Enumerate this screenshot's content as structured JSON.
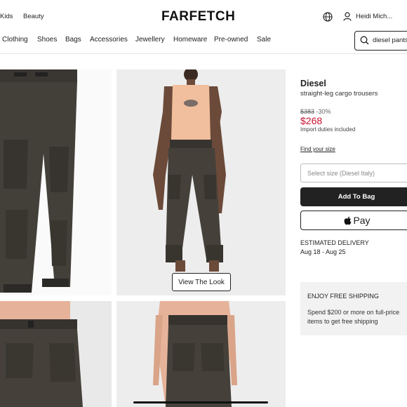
{
  "top_nav": {
    "kids": "Kids",
    "beauty": "Beauty",
    "logo": "FARFETCH",
    "user": "Heidi Mich..."
  },
  "categories": [
    "Clothing",
    "Shoes",
    "Bags",
    "Accessories",
    "Jewellery",
    "Homeware",
    "Pre-owned",
    "Sale"
  ],
  "search": {
    "value": "diesel pants"
  },
  "product": {
    "brand": "Diesel",
    "name": "straight-leg cargo trousers",
    "original_price": "$383",
    "discount": "-30%",
    "price": "$268",
    "duties": "Import duties included",
    "find_size": "Find your size",
    "size_placeholder": "Select size (Diesel Italy)",
    "add_to_bag": "Add To Bag",
    "apple_pay": "Pay"
  },
  "gallery": {
    "view_look": "View The Look"
  },
  "delivery": {
    "heading": "ESTIMATED DELIVERY",
    "dates": "Aug 18 - Aug 25"
  },
  "shipping": {
    "heading": "ENJOY FREE SHIPPING",
    "text": "Spend $200 or more on full-price items to get free shipping"
  },
  "colors": {
    "sale_red": "#c8102e",
    "dark": "#222222"
  }
}
